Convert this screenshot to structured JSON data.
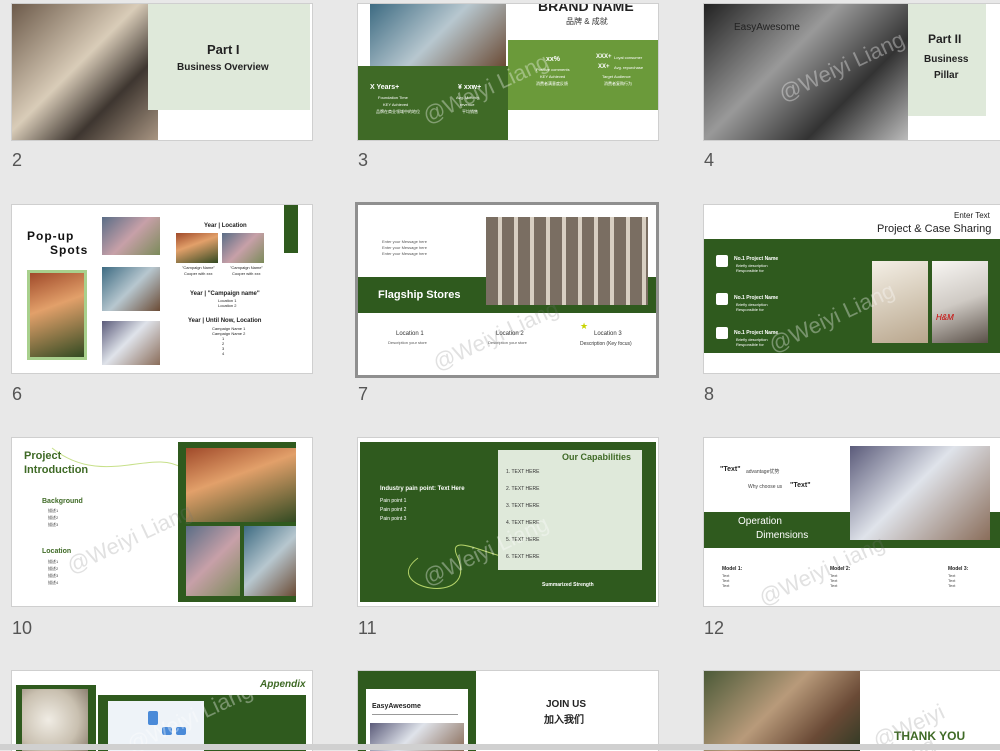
{
  "slides": [
    {
      "num": "2",
      "part": "Part I",
      "subtitle": "Business Overview"
    },
    {
      "num": "3",
      "brand": "BRAND NAME",
      "brand_cn": "品牌 & 成就",
      "s1": "X Years+",
      "s1a": "Foundation Time",
      "s1b": "KEY Achieved",
      "s1c": "品牌在商业领域中的地位",
      "s2": "¥ xxw+",
      "s2a": "Avg. Monthly",
      "s2b": "revenue",
      "s2c": "平均销售",
      "s3": "xx%",
      "s3a": "Positive comments",
      "s3b": "KEY Achieved",
      "s3c": "消费者满意度反馈",
      "s4": "XXX+",
      "s4a": "Loyal consumer",
      "s5": "XX+",
      "s5a": "Avg. repurchase",
      "s5b": "Target Audience",
      "s5c": "消费者复购行为"
    },
    {
      "num": "4",
      "brand": "EasyAwesome",
      "part": "Part II",
      "l1": "Business",
      "l2": "Pillar"
    },
    {
      "num": "6",
      "title1": "Pop-up",
      "title2": "Spots",
      "yl": "Year | Location",
      "cn1": "\"Campaign Name\"",
      "cn1b": "Cooper with xxx",
      "cn2": "\"Campaign Name\"",
      "cn2b": "Cooper with xxx",
      "yc": "Year | \"Campaign name\"",
      "yc1": "Location 1",
      "yc2": "Location 2",
      "yu": "Year | Until Now,  Location",
      "yu1": "Campaign Name 1",
      "yu2": "Campaign Name 2",
      "yu3": "1",
      "yu4": "2",
      "yu5": "3",
      "yu6": "4"
    },
    {
      "num": "7",
      "msg1": "Enter your Message here",
      "msg2": "Enter your Message here",
      "msg3": "Enter your Message here",
      "title": "Flagship Stores",
      "l1": "Location 1",
      "d1": "Description your store",
      "l2": "Location 2",
      "d2": "Description your store",
      "l3": "Location 3",
      "d3": "Description (Key focus)"
    },
    {
      "num": "8",
      "enter": "Enter Text",
      "title": "Project & Case Sharing",
      "p1": "No.1 Project Name",
      "p2": "No.1 Project Name",
      "p3": "No.1 Project Name",
      "b1": "Briefly description",
      "b2": "Responsible for",
      "hm": "H&M"
    },
    {
      "num": "10",
      "title1": "Project",
      "title2": "Introduction",
      "bg": "Background",
      "bg_items": [
        "描述1",
        "描述2",
        "描述3"
      ],
      "loc": "Location",
      "loc_items": [
        "描述1",
        "描述2",
        "描述3",
        "描述4"
      ]
    },
    {
      "num": "11",
      "pain": "Industry pain point:  Text Here",
      "pp1": "Pain point 1",
      "pp2": "Pain point 2",
      "pp3": "Pain point 3",
      "cap": "Our Capabilities",
      "items": [
        "1.  TEXT HERE",
        "2.  TEXT HERE",
        "3.  TEXT HERE",
        "4.  TEXT HERE",
        "5.  TEXT HERE",
        "6.  TEXT HERE"
      ],
      "sum": "Summarized Strength"
    },
    {
      "num": "12",
      "q1": "\"Text\"",
      "q1b": "advantage优势",
      "q2a": "Why choose us",
      "q2": "\"Text\"",
      "op1": "Operation",
      "op2": "Dimensions",
      "m1": "Model 1:",
      "m2": "Model 2:",
      "m3": "Model 3:",
      "txt": "Text"
    },
    {
      "num": "14",
      "appendix": "Appendix"
    },
    {
      "num": "15",
      "brand": "EasyAwesome",
      "join": "JOIN US",
      "join_cn": "加入我们"
    },
    {
      "num": "16",
      "thanks": "THANK YOU"
    }
  ],
  "watermark": "@Weiyi Liang"
}
